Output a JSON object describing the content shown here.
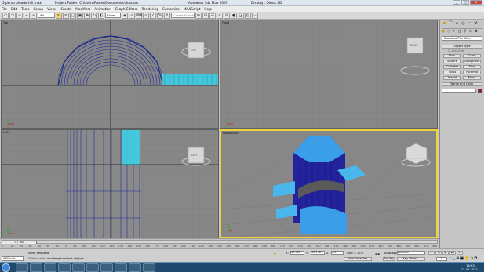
{
  "window": {
    "title": "5 pemo pleudo-fail.max",
    "project": "Project Folder: C:\\Users\\Power\\Documents\\3dsmax",
    "app": "Autodesk 3ds Max 2009",
    "display": "Display : Direct 3D",
    "min_label": "_",
    "max_label": "□",
    "close_label": "x"
  },
  "menu": [
    "File",
    "Edit",
    "Tools",
    "Group",
    "Views",
    "Create",
    "Modifiers",
    "Animation",
    "Graph Editors",
    "Rendering",
    "Customize",
    "MAXScript",
    "Help"
  ],
  "toolbar": {
    "filter_value": "All",
    "view_value": "View",
    "selection_set_placeholder": "Create Selection Se"
  },
  "viewports": {
    "top": "Top",
    "front": "Front",
    "left": "Left",
    "perspective": "Perspective",
    "top_cube": "TOP",
    "front_cube": "FRONT",
    "left_cube": "LEFT"
  },
  "command_panel": {
    "category": "Standard Primitives",
    "object_type_header": "Object Type",
    "autogrid": "AutoGrid",
    "buttons": [
      [
        "Box",
        "Cone"
      ],
      [
        "Sphere",
        "GeoSphere"
      ],
      [
        "Cylinder",
        "Tube"
      ],
      [
        "Torus",
        "Pyramid"
      ],
      [
        "Teapot",
        "Plane"
      ]
    ],
    "name_color_header": "Name and Color",
    "accent_color": "#9b1b30"
  },
  "timeline": {
    "frame": "0 / 100",
    "ticks": [
      "0",
      "10",
      "20",
      "30",
      "40",
      "50",
      "60",
      "70",
      "80",
      "90",
      "100",
      "110",
      "120",
      "130",
      "140",
      "150",
      "160",
      "170",
      "180",
      "190",
      "200",
      "210",
      "220",
      "230",
      "240",
      "250",
      "260",
      "270",
      "280",
      "290",
      "300",
      "310",
      "320",
      "330",
      "340",
      "350",
      "360",
      "370",
      "380",
      "390",
      "400",
      "410",
      "420",
      "430",
      "440",
      "450",
      "460",
      "470",
      "480"
    ]
  },
  "status": {
    "listener": "AXScript",
    "selection": "None Selected",
    "prompt": "Click or click-and-drag to select objects",
    "x_label": "X:",
    "x_value": "12.900",
    "y_label": "Y:",
    "y_value": "15.798",
    "z_label": "Z:",
    "z_value": "0.0",
    "grid": "Grid = 10.0",
    "add_time_tag": "Add Time Tag",
    "auto_key": "Auto Key",
    "selected": "Selected",
    "set_key": "Set Key",
    "key_filters": "Key Filters...",
    "frame_field": "0"
  },
  "taskbar": {
    "time": "16:33",
    "date": "22.06.2012"
  }
}
